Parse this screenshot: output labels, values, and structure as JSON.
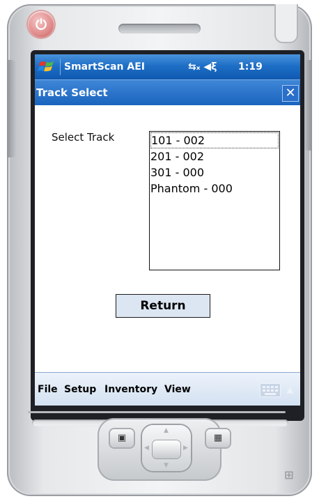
{
  "statusbar": {
    "app_name": "SmartScan AEI",
    "connectivity_icon": "connectivity-icon",
    "volume_icon": "speaker-muted-icon",
    "time": "1:19"
  },
  "titlebar": {
    "title": "Track Select",
    "close_glyph": "✕"
  },
  "content": {
    "select_label": "Select Track",
    "tracks": [
      "101 - 002",
      "201 - 002",
      "301 - 000",
      "Phantom - 000"
    ],
    "selected_index": 0,
    "return_label": "Return"
  },
  "menubar": {
    "items": [
      "File",
      "Setup",
      "Inventory",
      "View"
    ]
  },
  "colors": {
    "titlebar_blue": "#1a64bf",
    "menubar_bg": "#dbe6f3",
    "button_bg": "#dce6f2"
  }
}
